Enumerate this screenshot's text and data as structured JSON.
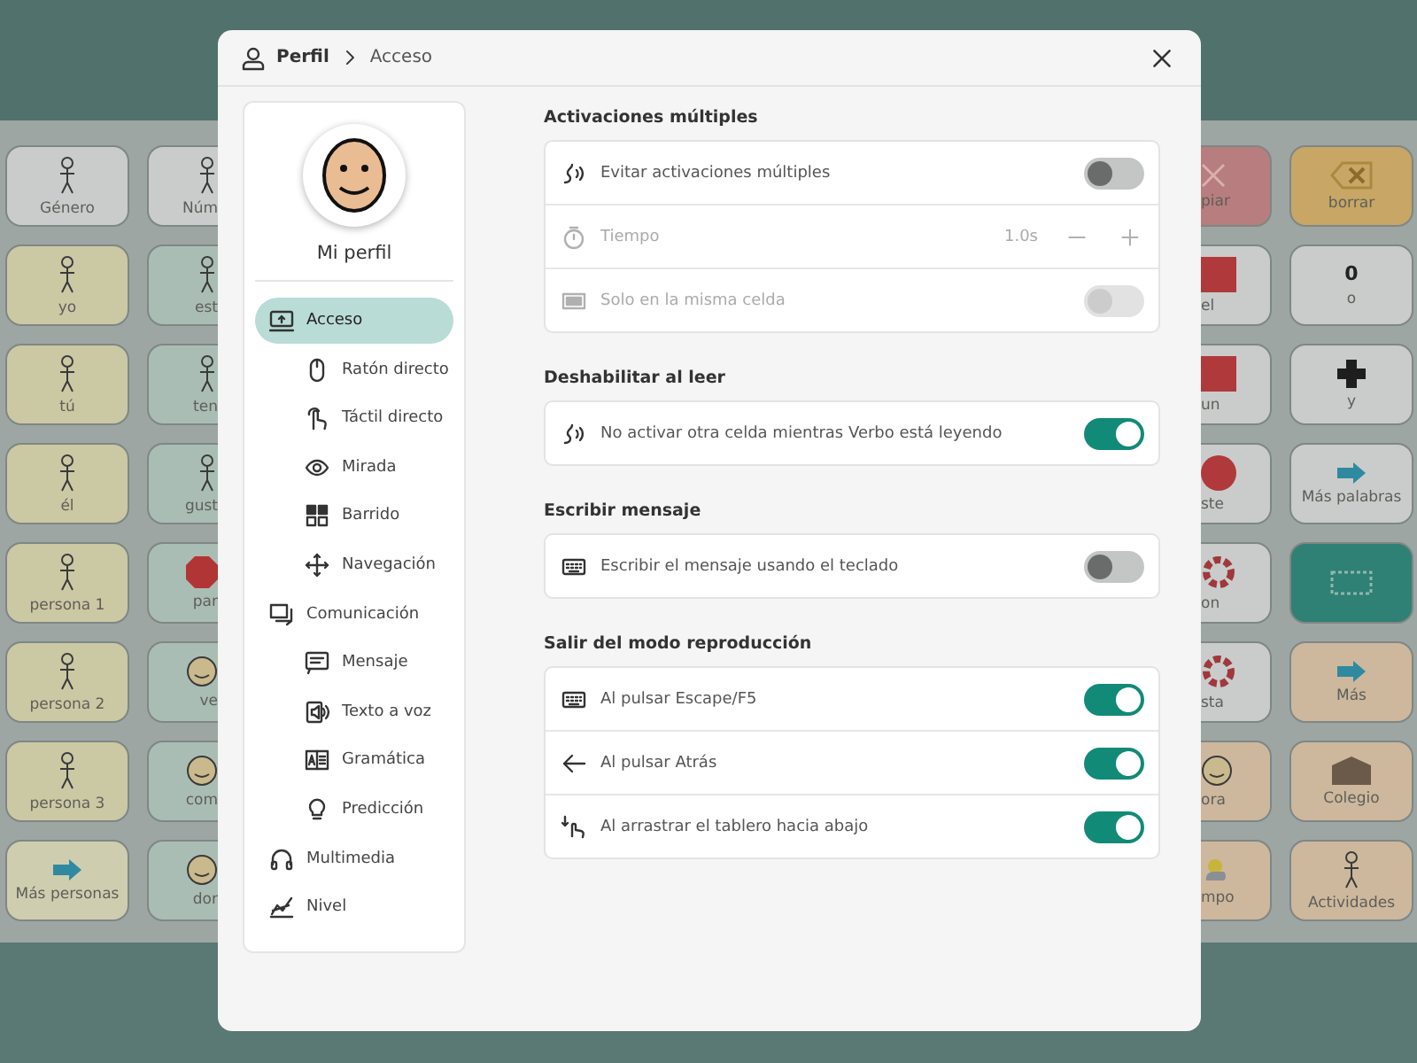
{
  "board": {
    "columns": [
      {
        "tiles": [
          {
            "label": "Género",
            "color": "#c9cccb",
            "kind": "figure"
          },
          {
            "label": "yo",
            "color": "#cbc8a4",
            "kind": "figure"
          },
          {
            "label": "tú",
            "color": "#cbc8a4",
            "kind": "figure"
          },
          {
            "label": "él",
            "color": "#cbc8a4",
            "kind": "figure"
          },
          {
            "label": "persona 1",
            "color": "#cbc8a4",
            "kind": "figure"
          },
          {
            "label": "persona 2",
            "color": "#cbc8a4",
            "kind": "figure"
          },
          {
            "label": "persona 3",
            "color": "#cbc8a4",
            "kind": "figure"
          },
          {
            "label": "Más personas",
            "color": "#cfcdaf",
            "kind": "arrow"
          }
        ]
      },
      {
        "tiles": [
          {
            "label": "Núm",
            "color": "#c9cccb",
            "kind": "figure"
          },
          {
            "label": "est",
            "color": "#aabdb4",
            "kind": "figure"
          },
          {
            "label": "ten",
            "color": "#aabdb4",
            "kind": "figure"
          },
          {
            "label": "gust",
            "color": "#aabdb4",
            "kind": "figure"
          },
          {
            "label": "par",
            "color": "#aabdb4",
            "kind": "stop"
          },
          {
            "label": "ve",
            "color": "#aabdb4",
            "kind": "face"
          },
          {
            "label": "com",
            "color": "#aabdb4",
            "kind": "face"
          },
          {
            "label": "dor",
            "color": "#aabdb4",
            "kind": "face"
          }
        ]
      },
      {
        "tiles": [
          {
            "label": "piar",
            "color": "#b87d7e",
            "kind": "cross"
          },
          {
            "label": "el",
            "color": "#c9cccb",
            "kind": "square"
          },
          {
            "label": "un",
            "color": "#c9cccb",
            "kind": "square"
          },
          {
            "label": "ste",
            "color": "#c9cccb",
            "kind": "circle"
          },
          {
            "label": "on",
            "color": "#c9cccb",
            "kind": "flower"
          },
          {
            "label": "sta",
            "color": "#c9cccb",
            "kind": "flower"
          },
          {
            "label": "ora",
            "color": "#cdb89d",
            "kind": "face"
          },
          {
            "label": "mpo",
            "color": "#cdb89d",
            "kind": "cloud"
          }
        ]
      },
      {
        "tiles": [
          {
            "label": "borrar",
            "color": "#c8a665",
            "kind": "erase"
          },
          {
            "label": "o",
            "color": "#c9cccb",
            "kind": "glyph",
            "glyph": "0"
          },
          {
            "label": "y",
            "color": "#c9cccb",
            "kind": "plus"
          },
          {
            "label": "Más palabras",
            "color": "#c9cccb",
            "kind": "arrow"
          },
          {
            "color": "#2f8075",
            "kind": "keys"
          },
          {
            "label": "Más",
            "color": "#cdb89d",
            "kind": "arrow"
          },
          {
            "label": "Colegio",
            "color": "#cdb89d",
            "kind": "building"
          },
          {
            "label": "Actividades",
            "color": "#cdb89d",
            "kind": "figure"
          }
        ]
      }
    ]
  },
  "dialog": {
    "breadcrumb": [
      "Perfil",
      "Acceso"
    ],
    "profile": {
      "name": "Mi perfil"
    },
    "nav": [
      {
        "label": "Acceso",
        "selected": true,
        "children": [
          {
            "label": "Ratón directo",
            "selected": false
          },
          {
            "label": "Táctil directo",
            "selected": false
          },
          {
            "label": "Mirada",
            "selected": false
          },
          {
            "label": "Barrido",
            "selected": false
          },
          {
            "label": "Navegación",
            "selected": false
          }
        ]
      },
      {
        "label": "Comunicación",
        "selected": false,
        "children": [
          {
            "label": "Mensaje",
            "selected": false
          },
          {
            "label": "Texto a voz",
            "selected": false
          },
          {
            "label": "Gramática",
            "selected": false
          },
          {
            "label": "Predicción",
            "selected": false
          }
        ]
      },
      {
        "label": "Multimedia",
        "selected": false
      },
      {
        "label": "Nivel",
        "selected": false
      }
    ],
    "sections": [
      {
        "title": "Activaciones múltiples",
        "rows": [
          {
            "kind": "toggle",
            "label": "Evitar activaciones múltiples",
            "on": false,
            "disabled": false
          },
          {
            "kind": "stepper",
            "label": "Tiempo",
            "value": "1.0s",
            "disabled": true
          },
          {
            "kind": "toggle",
            "label": "Solo en la misma celda",
            "on": false,
            "disabled": true
          }
        ]
      },
      {
        "title": "Deshabilitar al leer",
        "rows": [
          {
            "kind": "toggle",
            "label": "No activar otra celda mientras Verbo está leyendo",
            "on": true,
            "disabled": false
          }
        ]
      },
      {
        "title": "Escribir mensaje",
        "rows": [
          {
            "kind": "toggle",
            "label": "Escribir el mensaje usando el teclado",
            "on": false,
            "disabled": false
          }
        ]
      },
      {
        "title": "Salir del modo reproducción",
        "rows": [
          {
            "kind": "toggle",
            "label": "Al pulsar Escape/F5",
            "on": true,
            "disabled": false
          },
          {
            "kind": "toggle",
            "label": "Al pulsar Atrás",
            "on": true,
            "disabled": false
          },
          {
            "kind": "toggle",
            "label": "Al arrastrar el tablero hacia abajo",
            "on": true,
            "disabled": false
          }
        ]
      }
    ]
  }
}
